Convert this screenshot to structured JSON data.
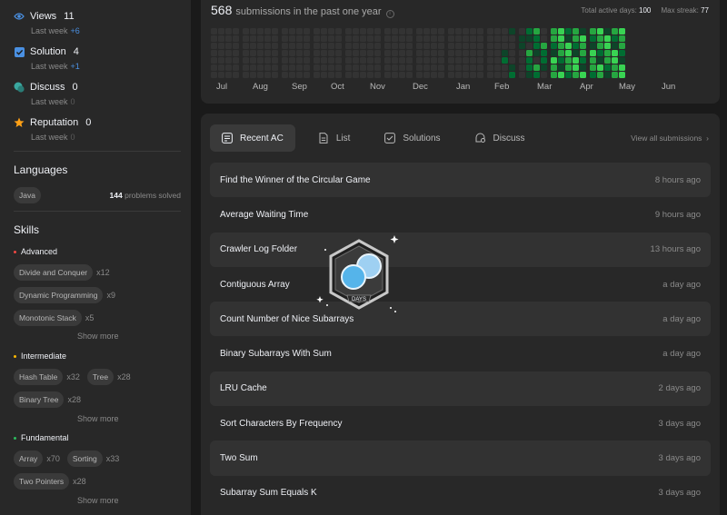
{
  "sidebar": {
    "stats": [
      {
        "name": "Views",
        "value": "11",
        "lw_label": "Last week",
        "delta": "+6",
        "delta_color": "blue",
        "icon": "eye-icon"
      },
      {
        "name": "Solution",
        "value": "4",
        "lw_label": "Last week",
        "delta": "+1",
        "delta_color": "blue",
        "icon": "checkbox-icon"
      },
      {
        "name": "Discuss",
        "value": "0",
        "lw_label": "Last week",
        "delta": "0",
        "delta_color": "zero",
        "icon": "chat-icon"
      },
      {
        "name": "Reputation",
        "value": "0",
        "lw_label": "Last week",
        "delta": "0",
        "delta_color": "zero",
        "icon": "star-icon"
      }
    ],
    "languages": {
      "title": "Languages",
      "items": [
        {
          "name": "Java",
          "count": "144",
          "suffix": "problems solved"
        }
      ]
    },
    "skills": {
      "title": "Skills",
      "groups": [
        {
          "level": "Advanced",
          "dot_color": "#ef4743",
          "rows": [
            [
              {
                "tag": "Divide and Conquer",
                "count": "x12"
              }
            ],
            [
              {
                "tag": "Dynamic Programming",
                "count": "x9"
              }
            ],
            [
              {
                "tag": "Monotonic Stack",
                "count": "x5"
              }
            ]
          ],
          "show_more": "Show more"
        },
        {
          "level": "Intermediate",
          "dot_color": "#ffb800",
          "rows": [
            [
              {
                "tag": "Hash Table",
                "count": "x32"
              },
              {
                "tag": "Tree",
                "count": "x28"
              }
            ],
            [
              {
                "tag": "Binary Tree",
                "count": "x28"
              }
            ]
          ],
          "show_more": "Show more"
        },
        {
          "level": "Fundamental",
          "dot_color": "#2cbb5d",
          "rows": [
            [
              {
                "tag": "Array",
                "count": "x70"
              },
              {
                "tag": "Sorting",
                "count": "x33"
              }
            ],
            [
              {
                "tag": "Two Pointers",
                "count": "x28"
              }
            ]
          ],
          "show_more": "Show more"
        }
      ]
    }
  },
  "heatmap": {
    "count": "568",
    "subtitle": "submissions in the past one year",
    "active_label": "Total active days:",
    "active_value": "100",
    "streak_label": "Max streak:",
    "streak_value": "77",
    "months": [
      "Jul",
      "Aug",
      "Sep",
      "Oct",
      "Nov",
      "Dec",
      "Jan",
      "Feb",
      "Mar",
      "Apr",
      "May",
      "Jun"
    ],
    "colors": {
      "empty": "#333333",
      "l1": "#0e4429",
      "l2": "#006d32",
      "l3": "#26a641",
      "l4": "#39d353"
    }
  },
  "submissions": {
    "tabs": [
      {
        "label": "Recent AC",
        "icon": "list-icon",
        "active": true
      },
      {
        "label": "List",
        "icon": "document-icon",
        "active": false
      },
      {
        "label": "Solutions",
        "icon": "checkbox-icon",
        "active": false
      },
      {
        "label": "Discuss",
        "icon": "chat-icon",
        "active": false
      }
    ],
    "view_all": "View all submissions",
    "items": [
      {
        "title": "Find the Winner of the Circular Game",
        "ago": "8 hours ago"
      },
      {
        "title": "Average Waiting Time",
        "ago": "9 hours ago"
      },
      {
        "title": "Crawler Log Folder",
        "ago": "13 hours ago"
      },
      {
        "title": "Contiguous Array",
        "ago": "a day ago"
      },
      {
        "title": "Count Number of Nice Subarrays",
        "ago": "a day ago"
      },
      {
        "title": "Binary Subarrays With Sum",
        "ago": "a day ago"
      },
      {
        "title": "LRU Cache",
        "ago": "2 days ago"
      },
      {
        "title": "Sort Characters By Frequency",
        "ago": "3 days ago"
      },
      {
        "title": "Two Sum",
        "ago": "3 days ago"
      },
      {
        "title": "Subarray Sum Equals K",
        "ago": "3 days ago"
      }
    ]
  },
  "badge": {
    "label": "DAYS",
    "icon": "days-badge-icon"
  }
}
